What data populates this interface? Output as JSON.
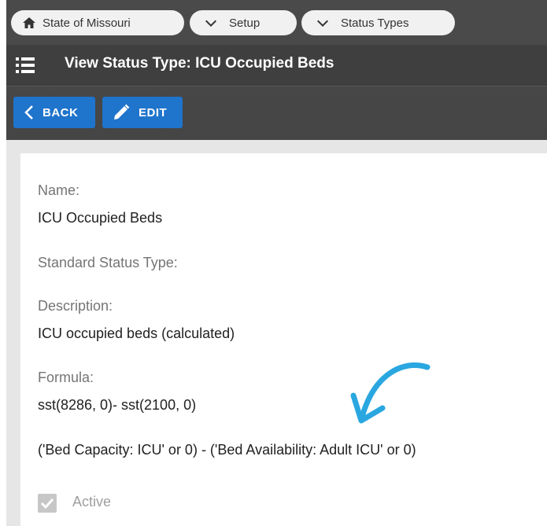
{
  "breadcrumbs": [
    {
      "label": "State of Missouri",
      "icon": "home-icon"
    },
    {
      "label": "Setup",
      "icon": "chevron-down-icon"
    },
    {
      "label": "Status Types",
      "icon": "chevron-down-icon"
    }
  ],
  "header": {
    "title": "View Status Type: ICU Occupied Beds",
    "menu_icon": "menu-list-icon"
  },
  "toolbar": {
    "back_label": "BACK",
    "edit_label": "EDIT"
  },
  "details": {
    "name_label": "Name:",
    "name_value": "ICU Occupied Beds",
    "standard_label": "Standard Status Type:",
    "description_label": "Description:",
    "description_value": "ICU occupied beds (calculated)",
    "formula_label": "Formula:",
    "formula_value": "sst(8286, 0)- sst(2100, 0)",
    "formula_readable": "('Bed Capacity: ICU' or 0) - ('Bed Availability: Adult ICU' or 0)",
    "active_label": "Active",
    "active_checked": true
  },
  "colors": {
    "accent": "#1f74cc",
    "annotation_arrow": "#2aa7e0",
    "header_bg": "#3f3f3f"
  }
}
